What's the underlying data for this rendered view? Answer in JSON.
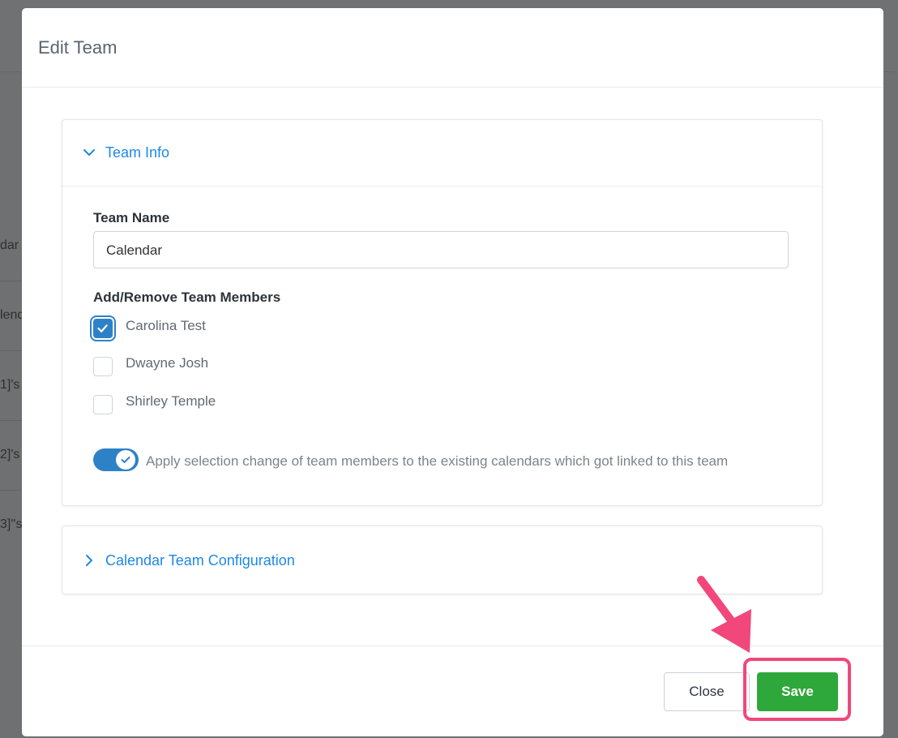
{
  "background": {
    "rows": [
      "dar",
      "lend",
      "1]'s",
      "2]'s",
      "3]''s"
    ]
  },
  "modal": {
    "title": "Edit Team",
    "team_info": {
      "title": "Team Info",
      "team_name_label": "Team Name",
      "team_name_value": "Calendar",
      "members_label": "Add/Remove Team Members",
      "members": [
        {
          "name": "Carolina Test",
          "checked": true
        },
        {
          "name": "Dwayne Josh",
          "checked": false
        },
        {
          "name": "Shirley Temple",
          "checked": false
        }
      ],
      "apply_toggle_on": true,
      "apply_toggle_label": "Apply selection change of team members to the existing calendars which got linked to this team"
    },
    "calendar_config": {
      "title": "Calendar Team Configuration"
    },
    "footer": {
      "close_label": "Close",
      "save_label": "Save"
    }
  },
  "colors": {
    "accent_blue": "#1e88e5",
    "checkbox_blue": "#2d82c7",
    "save_green": "#2ea83a",
    "annotation_pink": "#f1477b"
  }
}
